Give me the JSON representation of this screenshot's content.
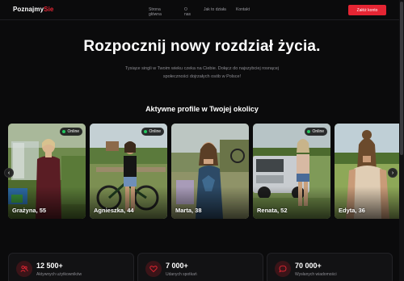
{
  "nav": {
    "logo_main": "Poznajmy",
    "logo_accent": "Sie",
    "links": [
      "Strona główna",
      "O nas",
      "Jak to działa",
      "Kontakt"
    ],
    "cta": "Załóż konto"
  },
  "hero": {
    "title": "Rozpocznij nowy rozdział życia.",
    "subtitle": "Tysiące singli w Twoim wieku czeka na Ciebie. Dołącz do najszybciej rosnącej społeczności dojrzałych osób w Polsce!"
  },
  "profiles": {
    "title": "Aktywne profile w Twojej okolicy",
    "badge": "Online",
    "cards": [
      {
        "name": "Grażyna, 55",
        "online": true
      },
      {
        "name": "Agnieszka, 44",
        "online": true
      },
      {
        "name": "Marta, 38",
        "online": false
      },
      {
        "name": "Renata, 52",
        "online": true
      },
      {
        "name": "Edyta, 36",
        "online": false
      }
    ]
  },
  "stats": [
    {
      "value": "12 500+",
      "label": "Aktywnych użytkowników",
      "icon": "users-icon"
    },
    {
      "value": "7 000+",
      "label": "Udanych spotkań",
      "icon": "heart-icon"
    },
    {
      "value": "70 000+",
      "label": "Wysłanych wiadomości",
      "icon": "message-icon"
    }
  ],
  "colors": {
    "accent": "#e52533",
    "online": "#22c55e",
    "background": "#0b0b0c"
  }
}
